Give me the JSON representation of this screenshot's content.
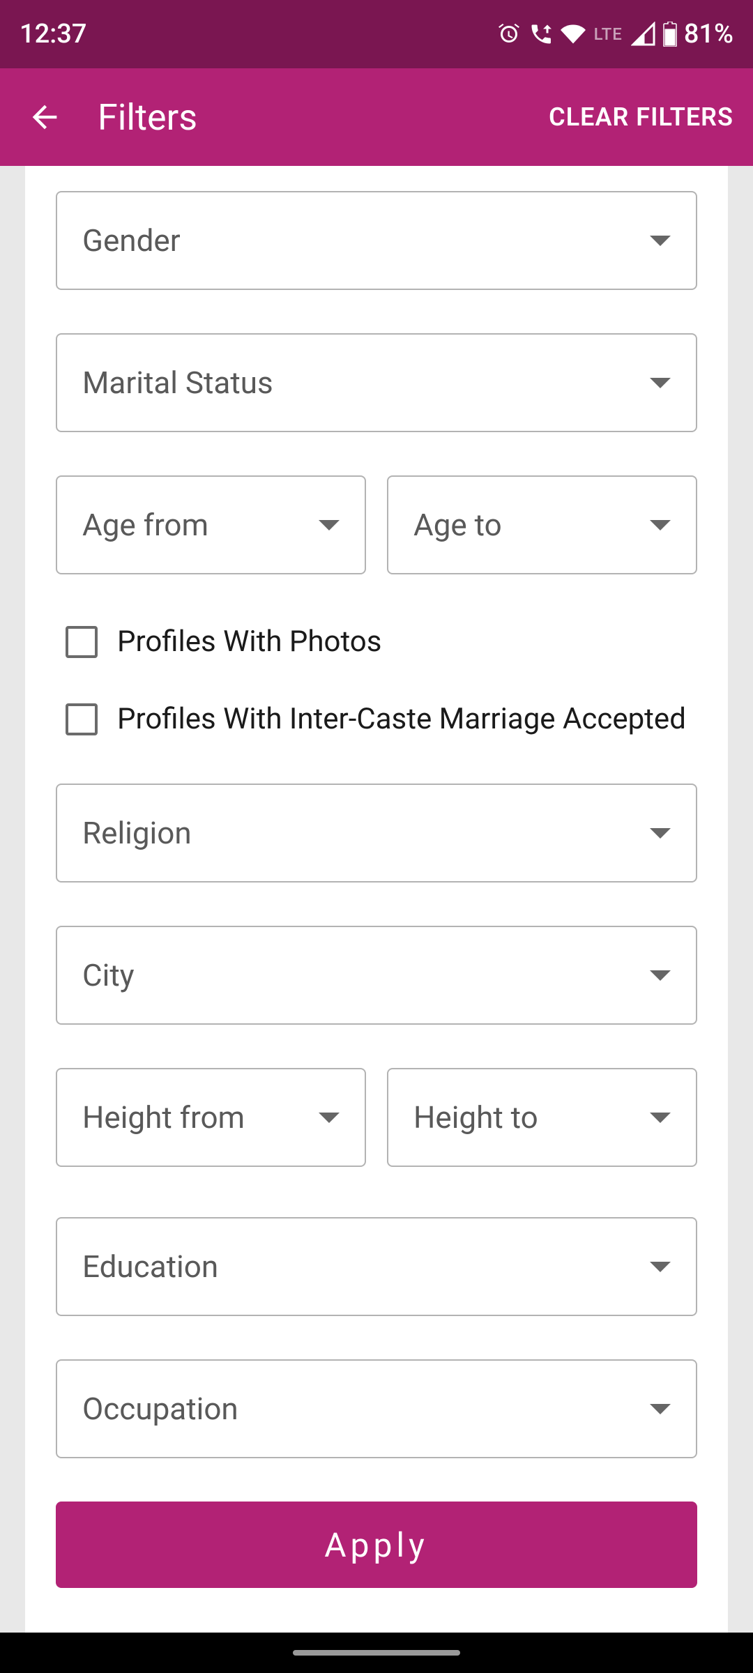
{
  "status": {
    "time": "12:37",
    "lte": "LTE",
    "battery": "81%"
  },
  "header": {
    "title": "Filters",
    "clear": "CLEAR FILTERS"
  },
  "filters": {
    "gender": "Gender",
    "marital_status": "Marital Status",
    "age_from": "Age from",
    "age_to": "Age to",
    "photos_checkbox": "Profiles With Photos",
    "intercaste_checkbox": "Profiles With Inter-Caste Marriage Accepted",
    "religion": "Religion",
    "city": "City",
    "height_from": "Height from",
    "height_to": "Height to",
    "education": "Education",
    "occupation": "Occupation"
  },
  "apply_label": "Apply"
}
